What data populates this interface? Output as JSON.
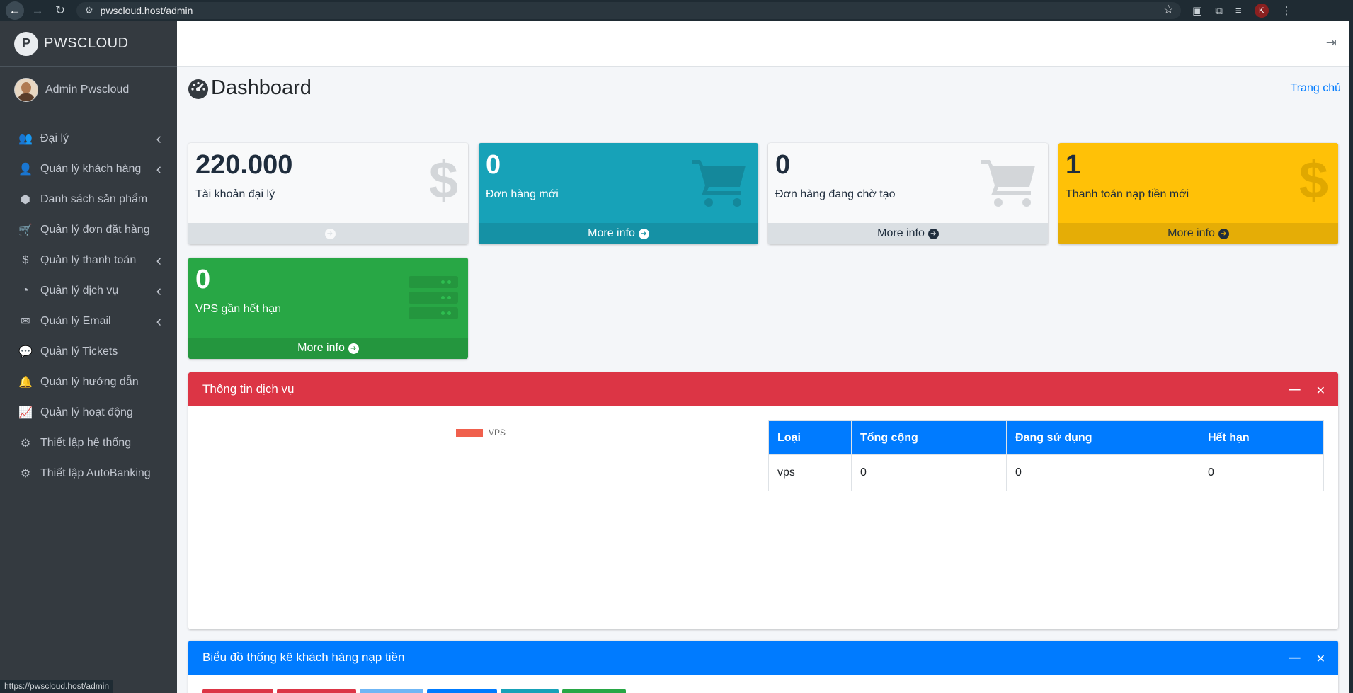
{
  "browser": {
    "url": "pwscloud.host/admin",
    "profile_initial": "K",
    "status_url": "https://pwscloud.host/admin"
  },
  "sidebar": {
    "brand": "PWSCLOUD",
    "user_name": "Admin Pwscloud",
    "items": [
      {
        "label": "Đại lý",
        "icon": "users-icon",
        "glyph": "👥",
        "has_caret": true
      },
      {
        "label": "Quản lý khách hàng",
        "icon": "user-icon",
        "glyph": "👤",
        "has_caret": true
      },
      {
        "label": "Danh sách sản phẩm",
        "icon": "cubes-icon",
        "glyph": "⬢",
        "has_caret": false
      },
      {
        "label": "Quản lý đơn đặt hàng",
        "icon": "cart-icon",
        "glyph": "🛒",
        "has_caret": false
      },
      {
        "label": "Quản lý thanh toán",
        "icon": "dollar-circle-icon",
        "glyph": "$",
        "has_caret": true
      },
      {
        "label": "Quản lý dịch vụ",
        "icon": "pie-chart-icon",
        "glyph": "◔",
        "has_caret": true
      },
      {
        "label": "Quản lý Email",
        "icon": "envelope-icon",
        "glyph": "✉",
        "has_caret": true
      },
      {
        "label": "Quản lý Tickets",
        "icon": "comments-icon",
        "glyph": "💬",
        "has_caret": false
      },
      {
        "label": "Quản lý hướng dẫn",
        "icon": "bell-icon",
        "glyph": "🔔",
        "has_caret": false
      },
      {
        "label": "Quản lý hoạt động",
        "icon": "line-chart-icon",
        "glyph": "📈",
        "has_caret": false
      },
      {
        "label": "Thiết lập hệ thống",
        "icon": "user-cog-icon",
        "glyph": "⚙",
        "has_caret": false
      },
      {
        "label": "Thiết lập AutoBanking",
        "icon": "cogs-icon",
        "glyph": "⚙",
        "has_caret": false
      }
    ]
  },
  "header": {
    "title": "Dashboard",
    "breadcrumb_home": "Trang chủ"
  },
  "stats": [
    {
      "value": "220.000",
      "label": "Tài khoản đại lý",
      "footer": "",
      "icon": "dollar-icon"
    },
    {
      "value": "0",
      "label": "Đơn hàng mới",
      "footer": "More info",
      "icon": "cart-icon"
    },
    {
      "value": "0",
      "label": "Đơn hàng đang chờ tạo",
      "footer": "More info",
      "icon": "cart-icon"
    },
    {
      "value": "1",
      "label": "Thanh toán nạp tiền mới",
      "footer": "More info",
      "icon": "dollar-icon"
    },
    {
      "value": "0",
      "label": "VPS gần hết hạn",
      "footer": "More info",
      "icon": "server-icon"
    }
  ],
  "service_card": {
    "title": "Thông tin dịch vụ",
    "legend": "VPS",
    "table": {
      "headers": [
        "Loại",
        "Tổng cộng",
        "Đang sử dụng",
        "Hết hạn"
      ],
      "rows": [
        [
          "vps",
          "0",
          "0",
          "0"
        ]
      ]
    }
  },
  "chart_card": {
    "title": "Biểu đồ thống kê khách hàng nạp tiền"
  },
  "colors": {
    "sidebar": "#343a40",
    "info": "#17a2b8",
    "warning": "#ffc107",
    "success": "#28a745",
    "danger": "#dc3545",
    "primary": "#007bff"
  }
}
